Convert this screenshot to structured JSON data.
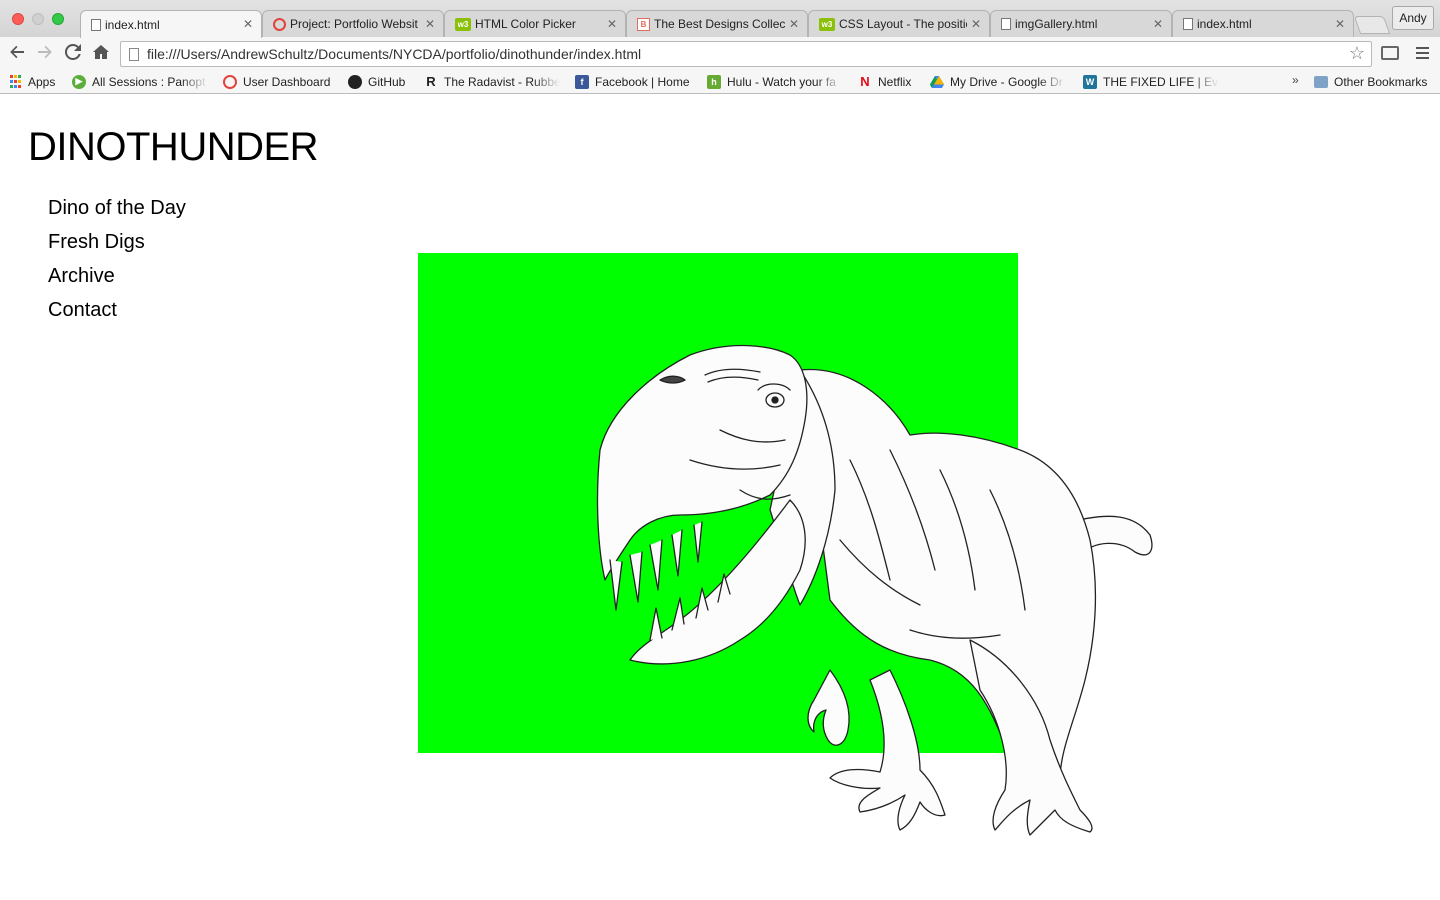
{
  "browser": {
    "tabs": [
      {
        "title": "index.html",
        "icon": "document-icon",
        "active": true
      },
      {
        "title": "Project: Portfolio Websit",
        "icon": "udemy-icon"
      },
      {
        "title": "HTML Color Picker",
        "icon": "w3schools-icon"
      },
      {
        "title": "The Best Designs Collec",
        "icon": "bestdesigns-icon"
      },
      {
        "title": "CSS Layout - The positio",
        "icon": "w3schools-icon"
      },
      {
        "title": "imgGallery.html",
        "icon": "document-icon"
      },
      {
        "title": "index.html",
        "icon": "document-icon"
      }
    ],
    "profile_name": "Andy",
    "url": "file:///Users/AndrewSchultz/Documents/NYCDA/portfolio/dinothunder/index.html",
    "bookmarks": [
      {
        "label": "Apps",
        "icon": "apps-grid-icon"
      },
      {
        "label": "All Sessions : Panopt",
        "icon": "panopto-icon"
      },
      {
        "label": "User Dashboard",
        "icon": "udemy-icon"
      },
      {
        "label": "GitHub",
        "icon": "github-icon"
      },
      {
        "label": "The Radavist - Rubbe",
        "icon": "radavist-icon"
      },
      {
        "label": "Facebook | Home",
        "icon": "facebook-icon"
      },
      {
        "label": "Hulu - Watch your fa",
        "icon": "hulu-icon"
      },
      {
        "label": "Netflix",
        "icon": "netflix-icon"
      },
      {
        "label": "My Drive - Google Dr",
        "icon": "google-drive-icon"
      },
      {
        "label": "THE FIXED LIFE | Eve",
        "icon": "wordpress-icon"
      }
    ],
    "overflow_chevron": "»",
    "other_bookmarks": "Other Bookmarks",
    "colors": {
      "close": "#fc5d57",
      "minimize": "#d0d0d0",
      "maximize": "#35c849"
    }
  },
  "site": {
    "title": "DINOTHUNDER",
    "nav": [
      "Dino of the Day",
      "Fresh Digs",
      "Archive",
      "Contact"
    ],
    "hero_color": "#00ff00",
    "hero_image": "t-rex-line-drawing"
  }
}
